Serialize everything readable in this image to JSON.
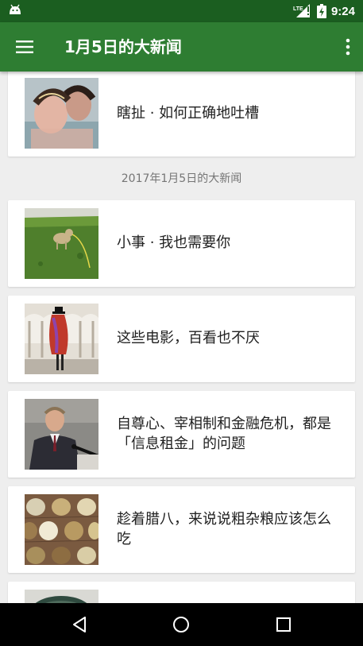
{
  "status_bar": {
    "time": "9:24",
    "network": "LTE"
  },
  "toolbar": {
    "title": "1月5日的大新闻"
  },
  "feed": {
    "section_header": "2017年1月5日的大新闻",
    "items": [
      {
        "title": "瞎扯 · 如何正确地吐槽"
      },
      {
        "title": "小事 · 我也需要你"
      },
      {
        "title": "这些电影，百看也不厌"
      },
      {
        "title": "自尊心、宰相制和金融危机，都是「信息租金」的问题"
      },
      {
        "title": "趁着腊八，来说说粗杂粮应该怎么吃"
      }
    ]
  },
  "colors": {
    "status_bar": "#1b5e20",
    "toolbar": "#2e7d32",
    "background": "#eeeeee"
  }
}
